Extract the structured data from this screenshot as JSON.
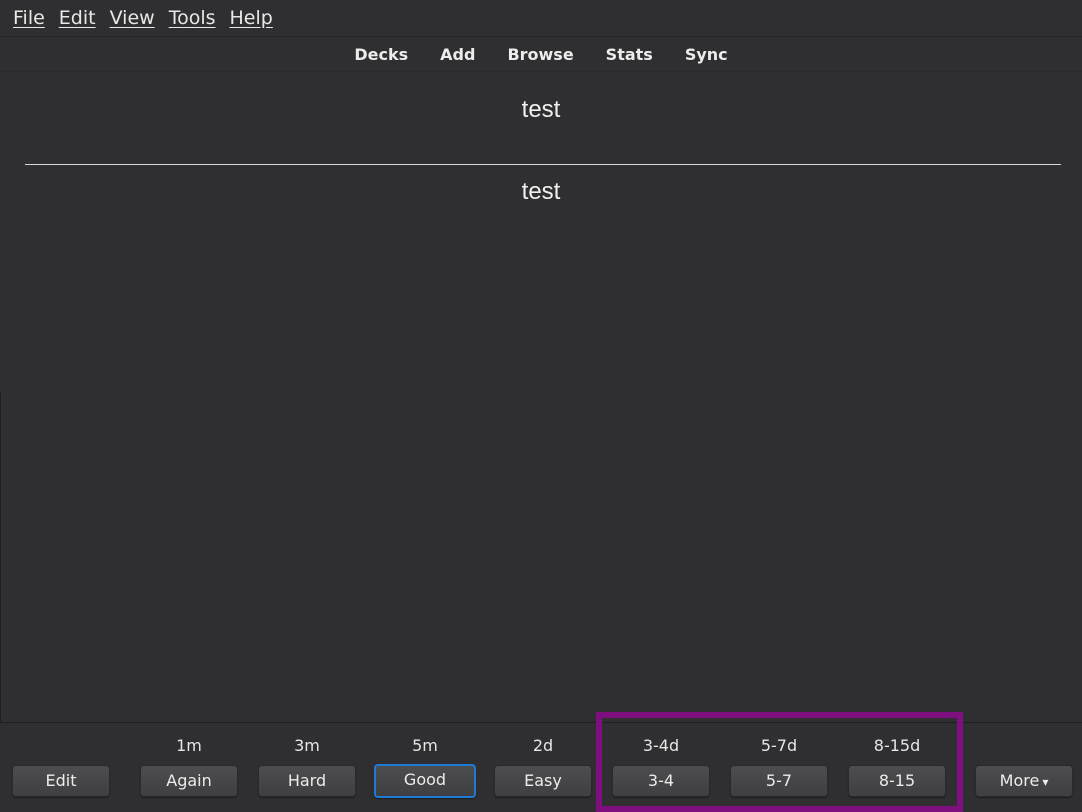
{
  "menu": {
    "items": [
      {
        "label": "File"
      },
      {
        "label": "Edit"
      },
      {
        "label": "View"
      },
      {
        "label": "Tools"
      },
      {
        "label": "Help"
      }
    ]
  },
  "toolbar": {
    "links": [
      {
        "label": "Decks"
      },
      {
        "label": "Add"
      },
      {
        "label": "Browse"
      },
      {
        "label": "Stats"
      },
      {
        "label": "Sync"
      }
    ]
  },
  "card": {
    "front": "test",
    "back": "test"
  },
  "bottom": {
    "edit_label": "Edit",
    "more_label": "More",
    "more_caret": "▾",
    "answers": [
      {
        "interval": "1m",
        "label": "Again"
      },
      {
        "interval": "3m",
        "label": "Hard"
      },
      {
        "interval": "5m",
        "label": "Good",
        "focused": true
      },
      {
        "interval": "2d",
        "label": "Easy"
      },
      {
        "interval": "3-4d",
        "label": "3-4"
      },
      {
        "interval": "5-7d",
        "label": "5-7"
      },
      {
        "interval": "8-15d",
        "label": "8-15"
      }
    ]
  },
  "colors": {
    "background": "#2f2f31",
    "button": "#464648",
    "focus_ring": "#1e7ad6",
    "highlight_box": "#7f0e7f"
  }
}
